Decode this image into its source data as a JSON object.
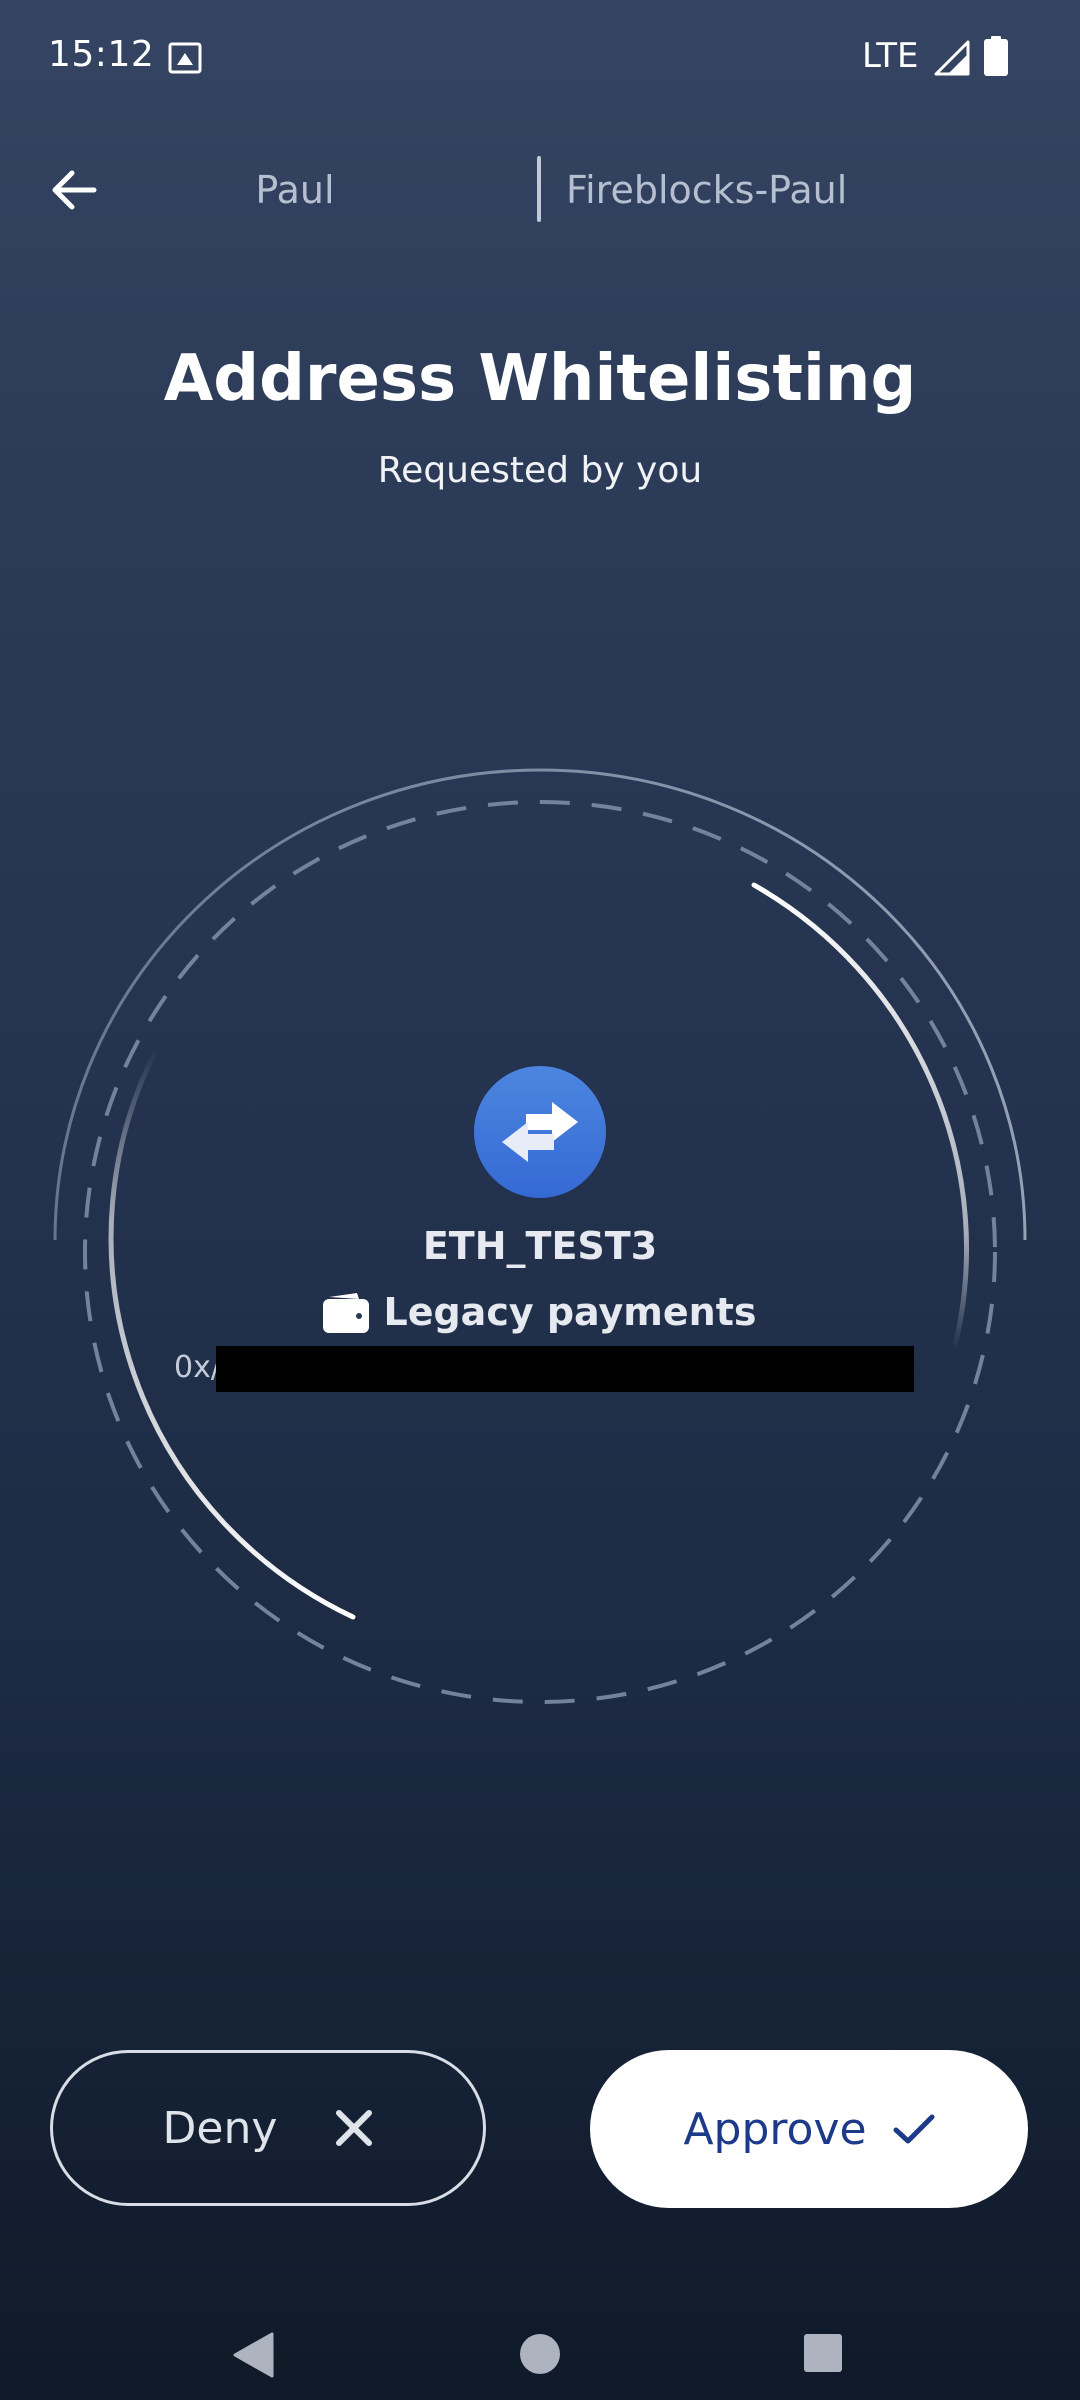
{
  "status_bar": {
    "time": "15:12",
    "network": "LTE",
    "icons": [
      "photo-icon",
      "signal-icon",
      "battery-icon"
    ]
  },
  "header": {
    "back_icon": "arrow-left-icon",
    "user": "Paul",
    "workspace": "Fireblocks-Paul"
  },
  "request": {
    "title": "Address Whitelisting",
    "subtitle": "Requested by you",
    "asset_icon": "swap-arrows-icon",
    "asset": "ETH_TEST3",
    "wallet_icon": "wallet-icon",
    "wallet": "Legacy payments",
    "address_prefix": "0x/"
  },
  "actions": {
    "deny_label": "Deny",
    "deny_icon": "close-icon",
    "approve_label": "Approve",
    "approve_icon": "check-icon"
  },
  "navigation": {
    "icons": [
      "nav-back-icon",
      "nav-home-icon",
      "nav-recents-icon"
    ]
  },
  "colors": {
    "background_top": "#344462",
    "background_bottom": "#0f1a29",
    "asset_icon_blue": "#3569d3",
    "approve_text": "#1d3a8a"
  }
}
